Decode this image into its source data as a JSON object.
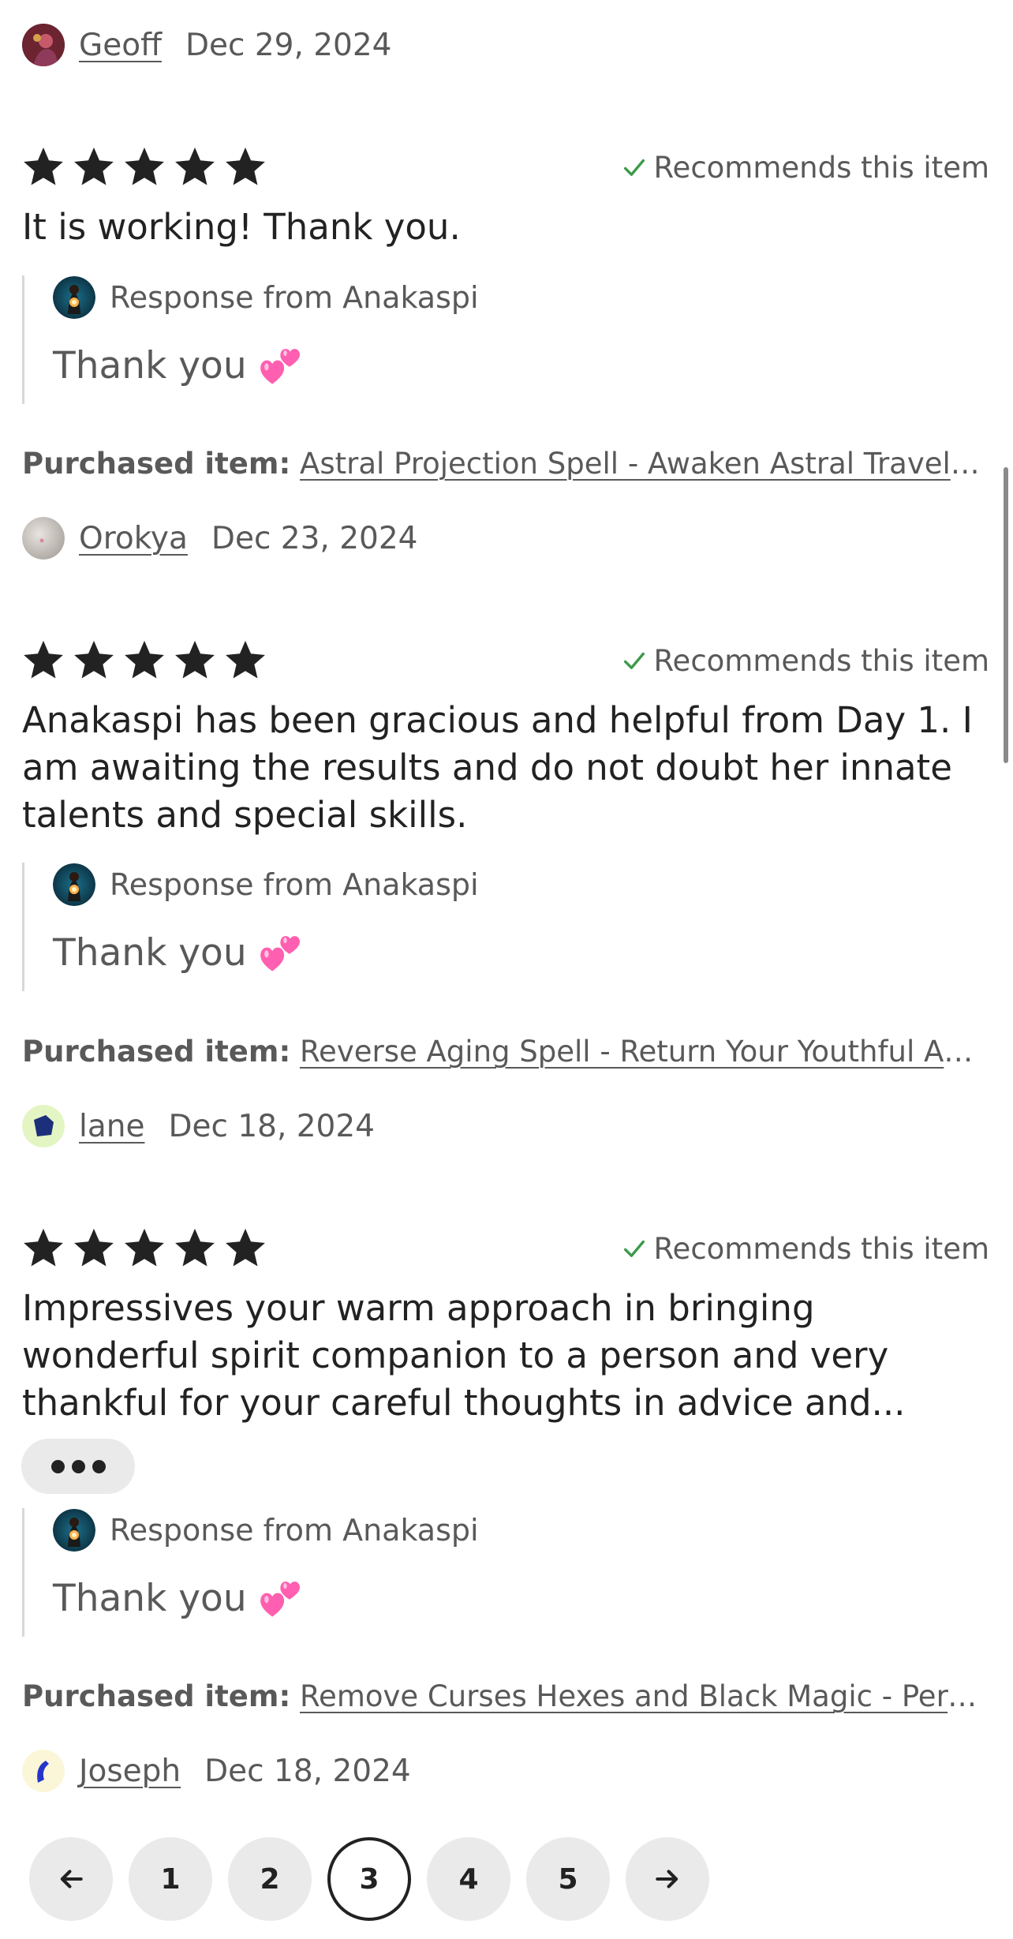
{
  "reviews": [
    {
      "reviewer": "Geoff",
      "date": "Dec 29, 2024",
      "rating": 5,
      "recommends": "Recommends this item",
      "text": "It is working! Thank you.",
      "response_from": "Response from Anakaspi",
      "response_text": "Thank you",
      "purchased_label": "Purchased item:",
      "purchased_item": "Astral Projection Spell - Awaken Astral Travel ..."
    },
    {
      "reviewer": "Orokya",
      "date": "Dec 23, 2024",
      "rating": 5,
      "recommends": "Recommends this item",
      "text": "Anakaspi has been gracious and helpful from Day 1. I am awaiting the results and do not doubt her innate talents and special skills.",
      "response_from": "Response from Anakaspi",
      "response_text": "Thank you",
      "purchased_label": "Purchased item:",
      "purchased_item": "Reverse Aging Spell - Return Your Youthful Ap..."
    },
    {
      "reviewer": "lane",
      "date": "Dec 18, 2024",
      "rating": 5,
      "recommends": "Recommends this item",
      "text": "Impressives your warm approach in bringing wonderful spirit companion to a person and very thankful for your careful thoughts in advice and...",
      "response_from": "Response from Anakaspi",
      "response_text": "Thank you",
      "purchased_label": "Purchased item:",
      "purchased_item": "Remove Curses Hexes and Black Magic - Perm..."
    },
    {
      "reviewer": "Joseph",
      "date": "Dec 18, 2024"
    }
  ],
  "icons": {
    "star": "star-icon",
    "check": "checkmark-icon",
    "heart": "two-hearts-emoji-icon",
    "more": "more-dots-icon",
    "prev": "arrow-left-icon",
    "next": "arrow-right-icon"
  },
  "colors": {
    "star": "#222222",
    "check": "#3c9a49",
    "heart": "#ff5fb0",
    "text_secondary": "#595959"
  },
  "pagination": {
    "pages": [
      "1",
      "2",
      "3",
      "4",
      "5"
    ],
    "current": "3"
  }
}
